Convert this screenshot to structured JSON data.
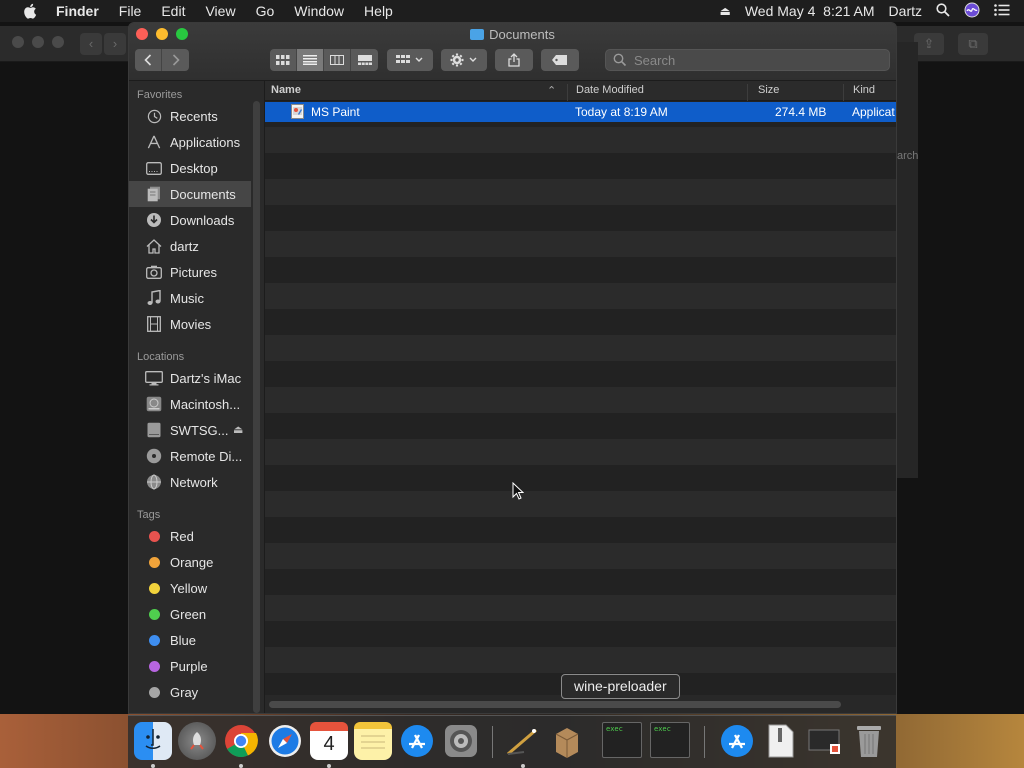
{
  "menubar": {
    "app_name": "Finder",
    "menus": [
      "File",
      "Edit",
      "View",
      "Go",
      "Window",
      "Help"
    ],
    "datetime": "Wed May 4  8:21 AM",
    "user": "Dartz"
  },
  "window": {
    "title": "Documents",
    "search_placeholder": "Search"
  },
  "sidebar": {
    "favorites_title": "Favorites",
    "favorites": [
      {
        "label": "Recents",
        "icon": "clock-icon"
      },
      {
        "label": "Applications",
        "icon": "applications-icon"
      },
      {
        "label": "Desktop",
        "icon": "desktop-icon"
      },
      {
        "label": "Documents",
        "icon": "document-icon",
        "selected": true
      },
      {
        "label": "Downloads",
        "icon": "download-icon"
      },
      {
        "label": "dartz",
        "icon": "home-icon"
      },
      {
        "label": "Pictures",
        "icon": "camera-icon"
      },
      {
        "label": "Music",
        "icon": "music-note-icon"
      },
      {
        "label": "Movies",
        "icon": "film-icon"
      }
    ],
    "locations_title": "Locations",
    "locations": [
      {
        "label": "Dartz's iMac",
        "icon": "imac-icon"
      },
      {
        "label": "Macintosh...",
        "icon": "hard-disk-icon"
      },
      {
        "label": "SWTSG...",
        "icon": "external-disk-icon",
        "eject": true
      },
      {
        "label": "Remote Di...",
        "icon": "optical-disc-icon"
      },
      {
        "label": "Network",
        "icon": "globe-icon"
      }
    ],
    "tags_title": "Tags",
    "tags": [
      {
        "label": "Red",
        "color": "#e8534f"
      },
      {
        "label": "Orange",
        "color": "#f0a33a"
      },
      {
        "label": "Yellow",
        "color": "#f2d33c"
      },
      {
        "label": "Green",
        "color": "#4fcf4e"
      },
      {
        "label": "Blue",
        "color": "#3e8ef0"
      },
      {
        "label": "Purple",
        "color": "#b765e0"
      },
      {
        "label": "Gray",
        "color": "#a5a5a5"
      }
    ]
  },
  "list": {
    "columns": {
      "name": "Name",
      "date": "Date Modified",
      "size": "Size",
      "kind": "Kind"
    },
    "files": [
      {
        "name": "MS Paint",
        "date": "Today at 8:19 AM",
        "size": "274.4 MB",
        "kind": "Applicat"
      }
    ]
  },
  "tooltip": "wine-preloader",
  "background_window": {
    "partial_text": "arch"
  },
  "colors": {
    "selection": "#0f5dc9",
    "accent": "#4aa3e6"
  }
}
